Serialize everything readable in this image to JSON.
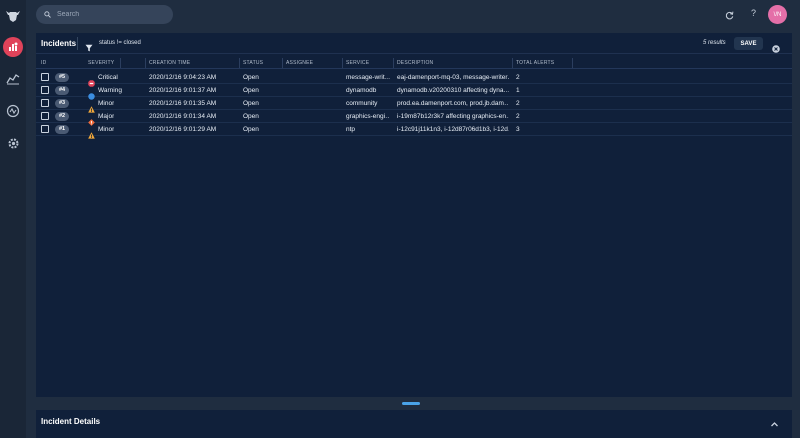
{
  "app": {
    "logo_icon": "bull-head-logo-icon",
    "rail": [
      {
        "icon": "alerts-dashboard-icon",
        "active": true
      },
      {
        "icon": "analytics-icon",
        "active": false
      },
      {
        "icon": "activity-icon",
        "active": false
      },
      {
        "icon": "gear-icon",
        "active": false
      }
    ]
  },
  "topbar": {
    "search_placeholder": "Search",
    "help_label": "?",
    "avatar_initials": "\\/N"
  },
  "incidents": {
    "title": "Incidents",
    "filter_text": "status != closed",
    "results_text": "5 results",
    "save_label": "SAVE",
    "columns": {
      "id": "ID",
      "severity": "SEVERITY",
      "creation_time": "CREATION TIME",
      "status": "STATUS",
      "assignee": "ASSIGNEE",
      "service": "SERVICE",
      "description": "DESCRIPTION",
      "total_alerts": "TOTAL ALERTS"
    },
    "rows": [
      {
        "id": "#5",
        "severity": "Critical",
        "severity_color": "#e0435a",
        "severity_shape": "octagon",
        "creation_time": "2020/12/16 9:04:23 AM",
        "status": "Open",
        "assignee": "",
        "service": "message-writ…",
        "description": "eaj-damenport-mq-03, message-writer…",
        "total_alerts": "2"
      },
      {
        "id": "#4",
        "severity": "Warning",
        "severity_color": "#3b8de0",
        "severity_shape": "circle",
        "creation_time": "2020/12/16 9:01:37 AM",
        "status": "Open",
        "assignee": "",
        "service": "dynamodb",
        "description": "dynamodb.v20200310 affecting dyna…",
        "total_alerts": "1"
      },
      {
        "id": "#3",
        "severity": "Minor",
        "severity_color": "#f2a93b",
        "severity_shape": "triangle",
        "creation_time": "2020/12/16 9:01:35 AM",
        "status": "Open",
        "assignee": "",
        "service": "community",
        "description": "prod.ea.damenport.com, prod.jb.dam…",
        "total_alerts": "2"
      },
      {
        "id": "#2",
        "severity": "Major",
        "severity_color": "#ee6b3b",
        "severity_shape": "diamond",
        "creation_time": "2020/12/16 9:01:34 AM",
        "status": "Open",
        "assignee": "",
        "service": "graphics-engi…",
        "description": "i-19m87b12r3k7 affecting graphics-en…",
        "total_alerts": "2"
      },
      {
        "id": "#1",
        "severity": "Minor",
        "severity_color": "#f2a93b",
        "severity_shape": "triangle",
        "creation_time": "2020/12/16 9:01:29 AM",
        "status": "Open",
        "assignee": "",
        "service": "ntp",
        "description": "i-12c91j11k1n3, i-12d87r06d1b3, i-12d…",
        "total_alerts": "3"
      }
    ]
  },
  "details": {
    "title": "Incident Details"
  }
}
